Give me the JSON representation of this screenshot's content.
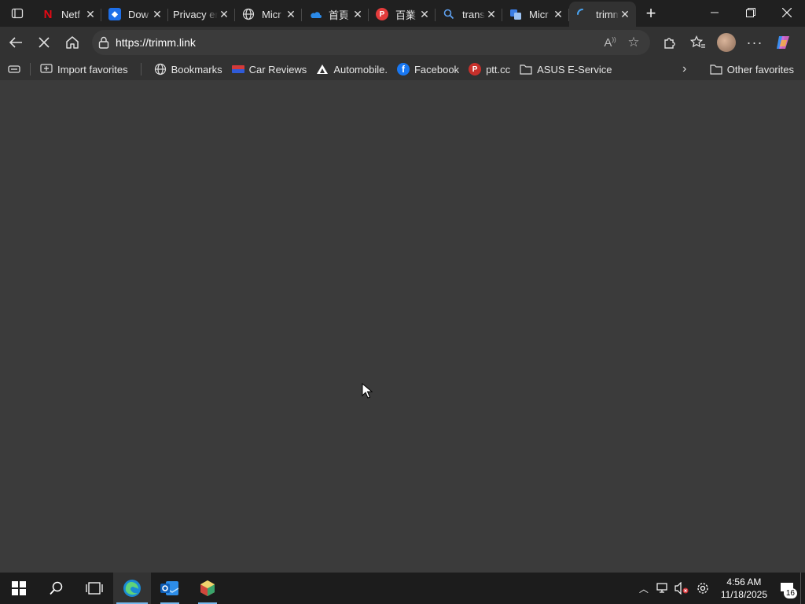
{
  "tabs": [
    {
      "title": "Netf",
      "icon": "netflix-icon",
      "color": "#e50914",
      "glyph": "N"
    },
    {
      "title": "Dow",
      "icon": "download-app-icon",
      "color": "#1e6fe8",
      "glyph": "◆"
    },
    {
      "title": "Privacy er",
      "icon": "",
      "color": "",
      "glyph": ""
    },
    {
      "title": "Micr",
      "icon": "globe-icon",
      "color": "",
      "glyph": ""
    },
    {
      "title": "首頁",
      "icon": "onedrive-icon",
      "color": "#2b8ae8",
      "glyph": ""
    },
    {
      "title": "百業",
      "icon": "pp-icon",
      "color": "#e33b3b",
      "glyph": "P"
    },
    {
      "title": "trans",
      "icon": "search-icon",
      "color": "",
      "glyph": ""
    },
    {
      "title": "Micr",
      "icon": "translator-icon",
      "color": "#3b7ee6",
      "glyph": ""
    },
    {
      "title": "trimm",
      "icon": "loading-icon",
      "color": "#4aa3f0",
      "glyph": ""
    }
  ],
  "address_bar": {
    "url": "https://trimm.link"
  },
  "favorites": [
    {
      "label": "Import favorites",
      "icon": "import-icon"
    },
    {
      "label": "Bookmarks",
      "icon": "globe-icon"
    },
    {
      "label": "Car Reviews",
      "icon": "car-reviews-icon"
    },
    {
      "label": "Automobile.",
      "icon": "automobile-icon"
    },
    {
      "label": "Facebook",
      "icon": "facebook-icon"
    },
    {
      "label": "ptt.cc",
      "icon": "ptt-icon"
    },
    {
      "label": "ASUS E-Service",
      "icon": "folder-icon"
    }
  ],
  "other_favorites": "Other favorites",
  "taskbar": {
    "time": "4:56 AM",
    "date": "11/18/2025",
    "notification_count": "16"
  },
  "colors": {
    "accent": "#76b9ed",
    "content_bg": "#3b3b3b"
  }
}
